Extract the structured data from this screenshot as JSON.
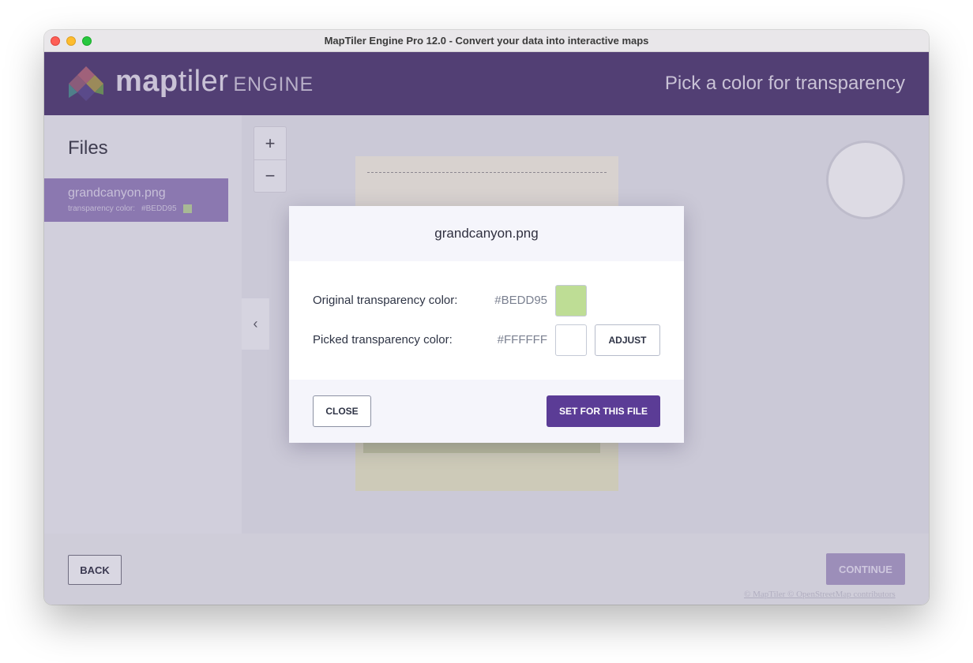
{
  "window": {
    "title": "MapTiler Engine Pro 12.0 - Convert your data into interactive maps"
  },
  "header": {
    "brand_bold": "map",
    "brand_light": "tiler",
    "brand_product": "ENGINE",
    "page_title": "Pick a color for transparency"
  },
  "sidebar": {
    "heading": "Files",
    "files": [
      {
        "name": "grandcanyon.png",
        "meta_label": "transparency color:",
        "meta_value": "#BEDD95"
      }
    ]
  },
  "map": {
    "zoom_in": "+",
    "zoom_out": "−",
    "collapse_glyph": "‹",
    "attribution": "© MapTiler © OpenStreetMap contributors"
  },
  "footer": {
    "back_label": "BACK",
    "continue_label": "CONTINUE"
  },
  "dialog": {
    "title": "grandcanyon.png",
    "original_label": "Original transparency color:",
    "original_value": "#BEDD95",
    "picked_label": "Picked transparency color:",
    "picked_value": "#FFFFFF",
    "adjust_label": "ADJUST",
    "close_label": "CLOSE",
    "set_label": "SET FOR THIS FILE"
  },
  "colors": {
    "header_bg": "#523f74",
    "accent": "#5b3c96",
    "original_swatch": "#BEDD95",
    "picked_swatch": "#FFFFFF"
  },
  "icons": {
    "logo": "maptiler-logo-icon",
    "zoom_in": "plus-icon",
    "zoom_out": "minus-icon",
    "collapse": "chevron-left-icon"
  }
}
